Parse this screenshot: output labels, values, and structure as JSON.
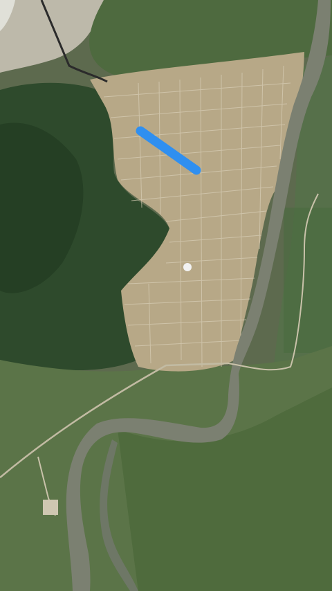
{
  "map": {
    "view": "satellite",
    "features": [
      {
        "kind": "river",
        "name": ""
      },
      {
        "kind": "town",
        "name": ""
      },
      {
        "kind": "forest",
        "name": ""
      },
      {
        "kind": "wetland",
        "name": ""
      }
    ],
    "highlight": {
      "kind": "route-segment",
      "color": "#2f8ff0"
    },
    "marker": {
      "kind": "location-dot",
      "color": "#f2f2f2"
    }
  }
}
